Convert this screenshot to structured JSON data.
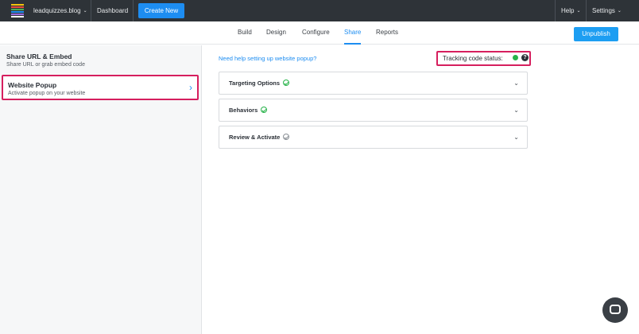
{
  "topbar": {
    "site_label": "leadquizzes.blog",
    "dashboard_label": "Dashboard",
    "create_new_label": "Create New",
    "help_label": "Help",
    "settings_label": "Settings",
    "caret": "⌄"
  },
  "tabs": [
    {
      "label": "Build"
    },
    {
      "label": "Design"
    },
    {
      "label": "Configure"
    },
    {
      "label": "Share",
      "active": true
    },
    {
      "label": "Reports"
    }
  ],
  "unpublish_label": "Unpublish",
  "sidebar": {
    "items": [
      {
        "title": "Share URL & Embed",
        "subtitle": "Share URL or grab embed code"
      },
      {
        "title": "Website Popup",
        "subtitle": "Activate popup on your website",
        "active": true
      }
    ],
    "chevron": "›"
  },
  "main": {
    "help_link": "Need help setting up website popup?",
    "tracking_label": "Tracking code status:",
    "tracking_help": "?",
    "tracking_color": "#28b34a",
    "panels": [
      {
        "label": "Targeting Options",
        "status": "complete"
      },
      {
        "label": "Behaviors",
        "status": "complete"
      },
      {
        "label": "Review & Activate",
        "status": "pending"
      }
    ],
    "chevron_down": "⌄"
  },
  "colors": {
    "accent": "#1d8df1",
    "highlight": "#d61f5e",
    "success": "#28b34a",
    "topbar": "#2e3338"
  },
  "icons": {
    "logo": "leadquizzes-logo-icon",
    "chat": "chat-bubble-icon"
  }
}
